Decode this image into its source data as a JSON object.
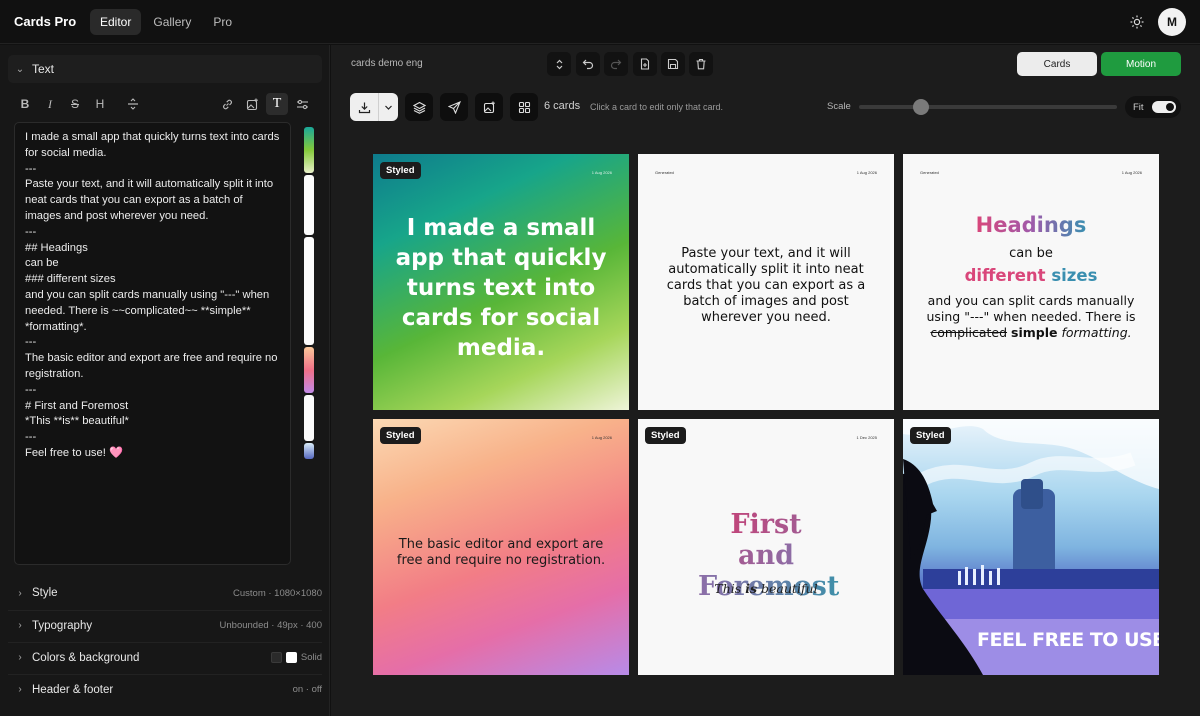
{
  "app": {
    "title": "Cards Pro",
    "tabs": [
      {
        "label": "Editor"
      },
      {
        "label": "Gallery"
      },
      {
        "label": "Pro"
      }
    ],
    "avatar_initial": "M"
  },
  "left": {
    "text_section": "Text",
    "editor_text": "I made a small app that quickly turns text into cards for social media.\n---\nPaste your text, and it will automatically split it into neat cards that you can export as a batch of images and post wherever you need.\n---\n## Headings\ncan be\n### different sizes\nand you can split cards manually using \"---\" when needed. There is ~~complicated~~ **simple** *formatting*.\n---\nThe basic editor and export are free and require no registration.\n---\n# First and Foremost\n*This **is** beautiful*\n---\nFeel free to use! 🩷",
    "rows": [
      {
        "label": "Style",
        "meta": "Custom · 1080×1080"
      },
      {
        "label": "Typography",
        "meta": "Unbounded · 49px · 400"
      },
      {
        "label": "Colors & background",
        "meta": "Solid"
      },
      {
        "label": "Header & footer",
        "meta": "on · off"
      }
    ]
  },
  "main": {
    "project_name": "cards demo eng",
    "mode_cards": "Cards",
    "mode_motion": "Motion",
    "count": "6 cards",
    "hint": "Click a card to edit only that card.",
    "scale_label": "Scale",
    "scale_value": 0.24,
    "fit_label": "Fit"
  },
  "cards": [
    {
      "badge": "Styled",
      "date": "1 Aug 2026",
      "text": "I made a small app that quickly turns text into cards for social media."
    },
    {
      "gen": "Generated",
      "date": "1 Aug 2026",
      "text": "Paste your text, and it will automatically split it into neat cards that you can export as a batch of images and post wherever you need."
    },
    {
      "gen": "Generated",
      "date": "1 Aug 2026",
      "h2": "Headings",
      "line1": "can be",
      "h3a": "different",
      "h3b": "sizes",
      "body1": "and you can split cards manually using \"---\" when needed. There is",
      "strike": "complicated",
      "bold": "simple",
      "ital": "formatting."
    },
    {
      "badge": "Styled",
      "date": "1 Aug 2026",
      "text": "The basic editor and export are free and require no registration."
    },
    {
      "badge": "Styled",
      "date": "1 Dec 2025",
      "h1": "First and Foremost",
      "it1": "This",
      "itb": "is",
      "it2": "beautiful"
    },
    {
      "badge": "Styled",
      "text": "FEEL FREE TO USE! 🩷"
    }
  ]
}
